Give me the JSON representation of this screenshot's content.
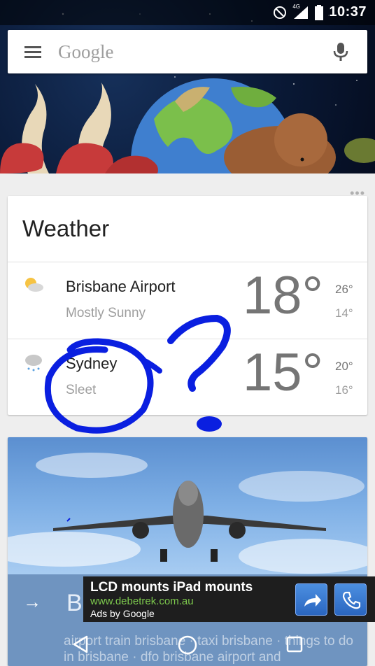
{
  "status_bar": {
    "time": "10:37",
    "network": "4G"
  },
  "search": {
    "brand": "Google"
  },
  "weather": {
    "title": "Weather",
    "locations": [
      {
        "city": "Brisbane Airport",
        "condition": "Mostly Sunny",
        "temp": "18°",
        "high": "26°",
        "low": "14°",
        "icon": "partly-sunny-icon"
      },
      {
        "city": "Sydney",
        "condition": "Sleet",
        "temp": "15°",
        "high": "20°",
        "low": "16°",
        "icon": "sleet-icon"
      }
    ]
  },
  "flight_card": {
    "title": "B",
    "related_text": "airport train brisbane · taxi brisbane · things to do in brisbane · dfo brisbane airport and"
  },
  "ad": {
    "headline": "LCD mounts iPad mounts",
    "url": "www.debetrek.com.au",
    "attribution": "Ads by Google"
  },
  "colors": {
    "scribble": "#0a1fe0",
    "ad_url": "#7dc94d",
    "footer": "#6f94c0"
  }
}
